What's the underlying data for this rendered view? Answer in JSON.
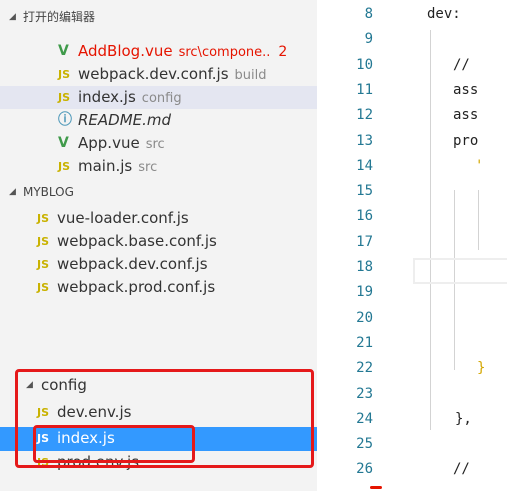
{
  "open_editors": {
    "header": "打开的编辑器",
    "files": [
      {
        "icon": "vue-icon",
        "glyph": "V",
        "name": "AddBlog.vue",
        "path": "src\\compone..",
        "badge": "2",
        "state": "error"
      },
      {
        "icon": "js-icon",
        "glyph": "JS",
        "name": "webpack.dev.conf.js",
        "path": "build",
        "state": "normal"
      },
      {
        "icon": "js-icon",
        "glyph": "JS",
        "name": "index.js",
        "path": "config",
        "state": "active"
      },
      {
        "icon": "info-icon",
        "glyph": "ⓘ",
        "name": "README.md",
        "path": "",
        "state": "preview"
      },
      {
        "icon": "vue-icon",
        "glyph": "V",
        "name": "App.vue",
        "path": "src",
        "state": "normal"
      },
      {
        "icon": "js-icon",
        "glyph": "JS",
        "name": "main.js",
        "path": "src",
        "state": "normal"
      }
    ]
  },
  "project": {
    "header": "MYBLOG",
    "files": [
      {
        "glyph": "JS",
        "name": "vue-loader.conf.js"
      },
      {
        "glyph": "JS",
        "name": "webpack.base.conf.js"
      },
      {
        "glyph": "JS",
        "name": "webpack.dev.conf.js"
      },
      {
        "glyph": "JS",
        "name": "webpack.prod.conf.js"
      }
    ],
    "folder": {
      "name": "config",
      "files": [
        {
          "glyph": "JS",
          "name": "dev.env.js",
          "selected": false
        },
        {
          "glyph": "JS",
          "name": "index.js",
          "selected": true
        },
        {
          "glyph": "JS",
          "name": "prod.env.js",
          "selected": false
        }
      ]
    }
  },
  "editor": {
    "lines": [
      {
        "num": "8",
        "code": "dev:"
      },
      {
        "num": "9",
        "code": ""
      },
      {
        "num": "10",
        "code": "//"
      },
      {
        "num": "11",
        "code": "ass"
      },
      {
        "num": "12",
        "code": "ass"
      },
      {
        "num": "13",
        "code": "pro"
      },
      {
        "num": "14",
        "code": "'"
      },
      {
        "num": "15",
        "code": ""
      },
      {
        "num": "16",
        "code": ""
      },
      {
        "num": "17",
        "code": ""
      },
      {
        "num": "18",
        "code": ""
      },
      {
        "num": "19",
        "code": ""
      },
      {
        "num": "20",
        "code": ""
      },
      {
        "num": "21",
        "code": ""
      },
      {
        "num": "22",
        "code": "}"
      },
      {
        "num": "23",
        "code": ""
      },
      {
        "num": "24",
        "code": "},"
      },
      {
        "num": "25",
        "code": ""
      },
      {
        "num": "26",
        "code": "//"
      }
    ]
  },
  "colors": {
    "selection": "#3399ff",
    "annotation_box": "#e5191a",
    "line_number": "#237893",
    "error": "#e51400"
  }
}
